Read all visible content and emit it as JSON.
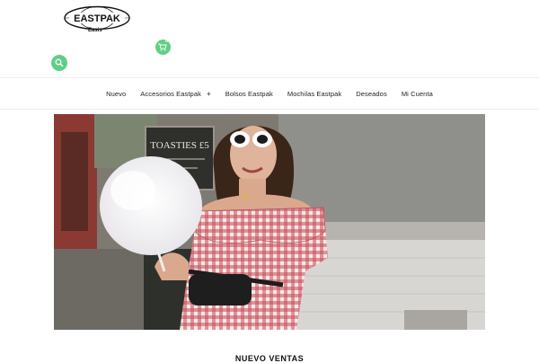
{
  "header": {
    "logo_text": "EASTPAK",
    "logo_sub": "Easis",
    "cart_count": "0",
    "accent_color": "#5fcf86"
  },
  "nav": {
    "items": [
      {
        "label": "Nuevo"
      },
      {
        "label": "Accesorios Eastpak",
        "has_submenu": true
      },
      {
        "label": "Bolsos Eastpak"
      },
      {
        "label": "Mochilas Eastpak"
      },
      {
        "label": "Deseados"
      },
      {
        "label": "Mi Cuenta"
      }
    ]
  },
  "hero": {
    "chalkboard_text": "TOASTIES £5",
    "subject": "woman in red gingham off-shoulder dress with white sunglasses holding cotton candy, wearing black Eastpak waist bag"
  },
  "section": {
    "title": "NUEVO VENTAS"
  }
}
